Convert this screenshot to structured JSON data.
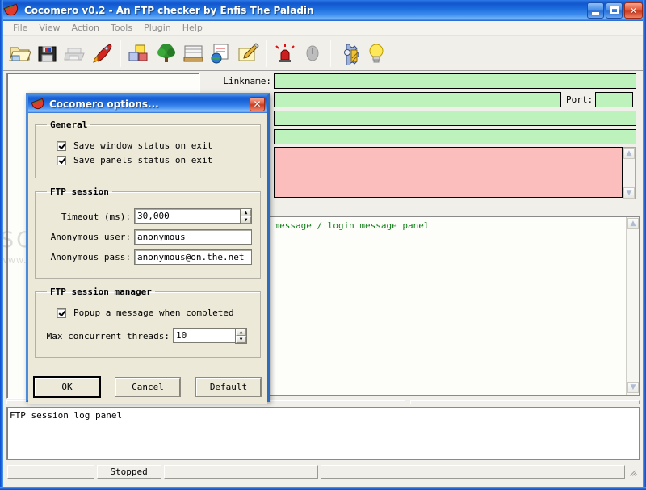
{
  "window": {
    "title": "Cocomero v0.2 - An FTP checker by Enfis The Paladin",
    "icon": "watermelon-icon",
    "minimize_label": "_",
    "maximize_label": "□",
    "close_label": "✕"
  },
  "menubar": {
    "items": [
      {
        "label": "File"
      },
      {
        "label": "View"
      },
      {
        "label": "Action"
      },
      {
        "label": "Tools"
      },
      {
        "label": "Plugin"
      },
      {
        "label": "Help"
      }
    ]
  },
  "toolbar": {
    "groups": [
      {
        "buttons": [
          {
            "icon": "open-folder-icon",
            "title": "Open"
          },
          {
            "icon": "floppy-save-icon",
            "title": "Save"
          },
          {
            "icon": "printer-icon",
            "title": "Print"
          },
          {
            "icon": "rocket-icon",
            "title": "Run"
          }
        ]
      },
      {
        "buttons": [
          {
            "icon": "blocks-icon",
            "title": "Blocks"
          },
          {
            "icon": "tree-icon",
            "title": "Tree"
          },
          {
            "icon": "card-index-icon",
            "title": "Index"
          },
          {
            "icon": "globe-report-icon",
            "title": "Report"
          },
          {
            "icon": "notepad-pencil-icon",
            "title": "Edit"
          }
        ]
      },
      {
        "buttons": [
          {
            "icon": "alarm-bell-icon",
            "title": "Alarm"
          },
          {
            "icon": "stop-button-icon",
            "title": "Stop"
          }
        ]
      },
      {
        "buttons": [
          {
            "icon": "gear-settings-icon",
            "title": "Settings"
          },
          {
            "icon": "lightbulb-icon",
            "title": "Tips"
          }
        ]
      }
    ]
  },
  "main": {
    "tree_panel": {
      "name": "site tree panel",
      "content": ""
    },
    "fields": [
      {
        "label": "Linkname:",
        "value": "",
        "color": "#bdf2bd"
      },
      {
        "label": "",
        "value": "",
        "color": "#bdf2bd"
      },
      {
        "label": "",
        "value": "",
        "color": "#bdf2bd"
      },
      {
        "label": "",
        "value": "",
        "color": "#bdf2bd"
      }
    ],
    "port_label": "Port:",
    "port_value": "",
    "message_panel_text": "FTP welcome message / login message panel",
    "log_panel_text": "FTP session log panel"
  },
  "statusbar": {
    "cells": [
      {
        "text": ""
      },
      {
        "text": "Stopped"
      },
      {
        "text": ""
      },
      {
        "text": ""
      }
    ]
  },
  "dialog": {
    "title": "Cocomero options...",
    "icon": "watermelon-icon",
    "close_label": "✕",
    "groups": {
      "general": {
        "legend": "General",
        "checkboxes": [
          {
            "label": "Save window status on exit",
            "checked": true
          },
          {
            "label": "Save panels status on exit",
            "checked": true
          }
        ]
      },
      "ftp_session": {
        "legend": "FTP session",
        "fields": [
          {
            "label": "Timeout (ms):",
            "value": "30,000",
            "type": "spinner"
          },
          {
            "label": "Anonymous user:",
            "value": "anonymous",
            "type": "text"
          },
          {
            "label": "Anonymous pass:",
            "value": "anonymous@on.the.net",
            "type": "text"
          }
        ]
      },
      "ftp_session_manager": {
        "legend": "FTP session manager",
        "checkboxes": [
          {
            "label": "Popup a message when completed",
            "checked": true
          }
        ],
        "fields": [
          {
            "label": "Max concurrent threads:",
            "value": "10",
            "type": "spinner"
          }
        ]
      }
    },
    "buttons": [
      {
        "label": "OK",
        "default": true
      },
      {
        "label": "Cancel",
        "default": false
      },
      {
        "label": "Default",
        "default": false
      }
    ],
    "spinner_up": "▲",
    "spinner_down": "▼"
  },
  "watermark": {
    "line1": "SOFTPEDIA",
    "line2": "www.softpedia.com"
  },
  "colors": {
    "titlebar_blue": "#1157ce",
    "green_field": "#bdf2bd",
    "pink_field": "#fcbdbd",
    "green_text": "#15801a",
    "dialog_face": "#ece9d8"
  }
}
